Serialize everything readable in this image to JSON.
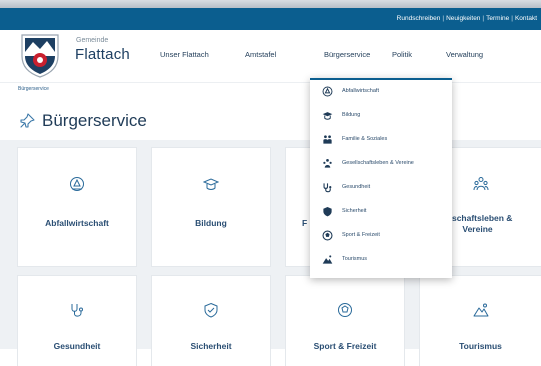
{
  "topbar": {
    "links": [
      "Rundschreiben",
      "Neuigkeiten",
      "Termine",
      "Kontakt"
    ]
  },
  "brand": {
    "small": "Gemeinde",
    "name": "Flattach"
  },
  "nav": {
    "items": [
      "Unser Flattach",
      "Amtstafel",
      "Bürgerservice",
      "Politik",
      "Verwaltung"
    ]
  },
  "breadcrumb": "Bürgerservice",
  "page": {
    "title": "Bürgerservice"
  },
  "cards": [
    {
      "label": "Abfallwirtschaft",
      "icon": "recycling-icon"
    },
    {
      "label": "Bildung",
      "icon": "graduation-icon"
    },
    {
      "label": "F",
      "icon": "family-icon"
    },
    {
      "label": "ellschaftsleben &\nVereine",
      "icon": "community-icon"
    },
    {
      "label": "Gesundheit",
      "icon": "stethoscope-icon"
    },
    {
      "label": "Sicherheit",
      "icon": "shield-icon"
    },
    {
      "label": "Sport & Freizeit",
      "icon": "ball-icon"
    },
    {
      "label": "Tourismus",
      "icon": "mountain-icon"
    }
  ],
  "dropdown": {
    "items": [
      {
        "label": "Abfallwirtschaft",
        "icon": "recycling-icon"
      },
      {
        "label": "Bildung",
        "icon": "graduation-icon"
      },
      {
        "label": "Familie & Soziales",
        "icon": "family-icon"
      },
      {
        "label": "Gesellschaftsleben & Vereine",
        "icon": "community-icon"
      },
      {
        "label": "Gesundheit",
        "icon": "stethoscope-icon"
      },
      {
        "label": "Sicherheit",
        "icon": "shield-icon"
      },
      {
        "label": "Sport & Freizeit",
        "icon": "ball-icon"
      },
      {
        "label": "Tourismus",
        "icon": "mountain-icon"
      }
    ]
  },
  "colors": {
    "primary": "#0b5e8f",
    "text": "#1f3b57",
    "grid_bg": "#eef1f4",
    "logo_red": "#c8202f"
  }
}
